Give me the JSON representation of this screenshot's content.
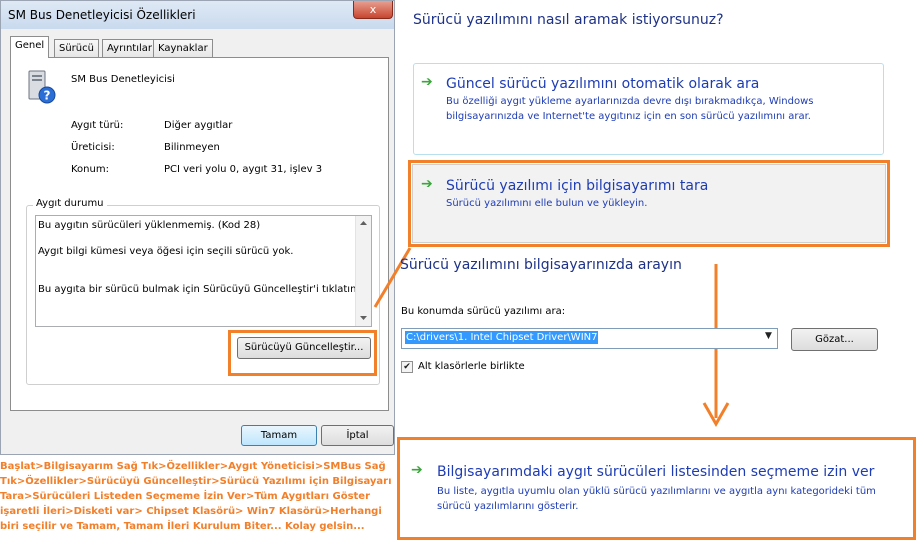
{
  "dialog": {
    "title": "SM Bus Denetleyicisi Özellikleri",
    "close_glyph": "x",
    "tabs": [
      {
        "label": "Genel"
      },
      {
        "label": "Sürücü"
      },
      {
        "label": "Ayrıntılar"
      },
      {
        "label": "Kaynaklar"
      }
    ],
    "device_name": "SM Bus Denetleyicisi",
    "properties": [
      {
        "label": "Aygıt türü:",
        "value": "Diğer aygıtlar"
      },
      {
        "label": "Üreticisi:",
        "value": "Bilinmeyen"
      },
      {
        "label": "Konum:",
        "value": "PCI veri yolu 0, aygıt 31, işlev 3"
      }
    ],
    "status_group_label": "Aygıt durumu",
    "status_lines": [
      "Bu aygıtın sürücüleri yüklenmemiş. (Kod 28)",
      "Aygıt bilgi kümesi veya öğesi için seçili sürücü yok.",
      "Bu aygıta bir sürücü bulmak için Sürücüyü Güncelleştir'i tıklatın."
    ],
    "update_driver_button": "Sürücüyü Güncelleştir...",
    "ok_button": "Tamam",
    "cancel_button": "İptal"
  },
  "wizard": {
    "question": "Sürücü yazılımını nasıl aramak istiyorsunuz?",
    "option_auto": {
      "title": "Güncel sürücü yazılımını otomatik olarak ara",
      "desc_lines": [
        "Bu özelliği aygıt yükleme ayarlarınızda devre dışı bırakmadıkça, Windows",
        "bilgisayarınızda ve Internet'te aygıtınız için en son sürücü yazılımını arar."
      ]
    },
    "option_browse": {
      "title": "Sürücü yazılımı için bilgisayarımı tara",
      "desc": "Sürücü yazılımını elle bulun ve yükleyin."
    },
    "browse_heading": "Sürücü yazılımını bilgisayarınızda arayın",
    "search_label": "Bu konumda sürücü yazılımı ara:",
    "path_value": "C:\\drivers\\1. Intel Chipset Driver\\WIN7",
    "browse_button": "Gözat...",
    "include_subfolders": "Alt klasörlerle birlikte",
    "include_subfolders_checked": true,
    "option_pick": {
      "title": "Bilgisayarımdaki aygıt sürücüleri listesinden seçmeme izin ver",
      "desc_lines": [
        "Bu liste, aygıtla uyumlu olan yüklü sürücü yazılımlarını ve aygıtla aynı kategorideki tüm",
        "sürücü yazılımlarını gösterir."
      ]
    }
  },
  "instructions": "Başlat>Bilgisayarım Sağ Tık>Özellikler>Aygıt Yöneticisi>SMBus Sağ Tık>Özellikler>Sürücüyü Güncelleştir>Sürücü Yazılımı için Bilgisayarı Tara>Sürücüleri Listeden Seçmeme İzin Ver>Tüm Aygıtları Göster işaretli İleri>Disketi var> Chipset Klasörü> Win7 Klasörü>Herhangi biri seçilir ve Tamam, Tamam İleri Kurulum Biter... Kolay gelsin...",
  "colors": {
    "highlight_orange": "#f27f2a",
    "link_blue": "#1e3cb4",
    "heading_blue": "#1e3287",
    "arrow_green": "#3aa63a"
  }
}
